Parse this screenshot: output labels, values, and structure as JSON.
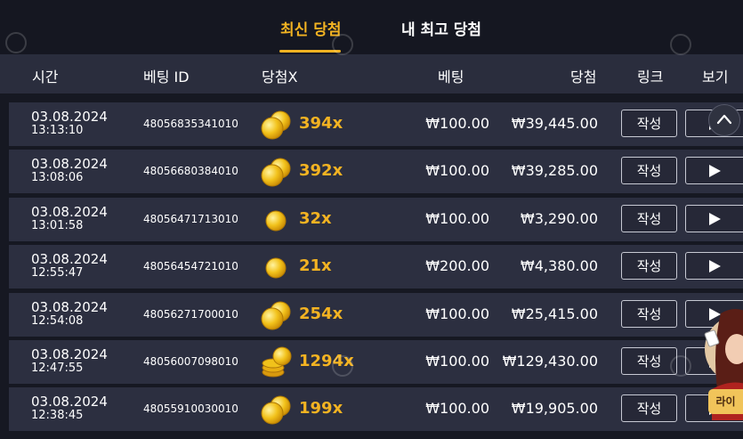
{
  "tabs": [
    {
      "label": "최신 당첨",
      "active": true
    },
    {
      "label": "내 최고 당첨",
      "active": false
    }
  ],
  "columns": {
    "time": "시간",
    "bet_id": "베팅 ID",
    "multiplier": "당첨X",
    "bet": "베팅",
    "win": "당첨",
    "link": "링크",
    "view": "보기"
  },
  "rows": [
    {
      "date": "03.08.2024",
      "time": "13:13:10",
      "bet_id": "48056835341010",
      "coin": "double",
      "multiplier": "394x",
      "bet": "₩100.00",
      "win": "₩39,445.00",
      "write_label": "작성"
    },
    {
      "date": "03.08.2024",
      "time": "13:08:06",
      "bet_id": "48056680384010",
      "coin": "double",
      "multiplier": "392x",
      "bet": "₩100.00",
      "win": "₩39,285.00",
      "write_label": "작성"
    },
    {
      "date": "03.08.2024",
      "time": "13:01:58",
      "bet_id": "48056471713010",
      "coin": "single",
      "multiplier": "32x",
      "bet": "₩100.00",
      "win": "₩3,290.00",
      "write_label": "작성"
    },
    {
      "date": "03.08.2024",
      "time": "12:55:47",
      "bet_id": "48056454721010",
      "coin": "single",
      "multiplier": "21x",
      "bet": "₩200.00",
      "win": "₩4,380.00",
      "write_label": "작성"
    },
    {
      "date": "03.08.2024",
      "time": "12:54:08",
      "bet_id": "48056271700010",
      "coin": "double",
      "multiplier": "254x",
      "bet": "₩100.00",
      "win": "₩25,415.00",
      "write_label": "작성"
    },
    {
      "date": "03.08.2024",
      "time": "12:47:55",
      "bet_id": "48056007098010",
      "coin": "stack",
      "multiplier": "1294x",
      "bet": "₩100.00",
      "win": "₩129,430.00",
      "write_label": "작성"
    },
    {
      "date": "03.08.2024",
      "time": "12:38:45",
      "bet_id": "48055910030010",
      "coin": "double",
      "multiplier": "199x",
      "bet": "₩100.00",
      "win": "₩19,905.00",
      "write_label": "작성"
    }
  ],
  "live_widget": {
    "label": "라이"
  },
  "icons": {
    "scroll_top": "chevron-up-icon",
    "play": "play-icon",
    "coin": "gold-coin-icon"
  },
  "colors": {
    "accent": "#f3b322",
    "background": "#161822",
    "row": "#2c2f40",
    "header": "#2a2d3d"
  }
}
